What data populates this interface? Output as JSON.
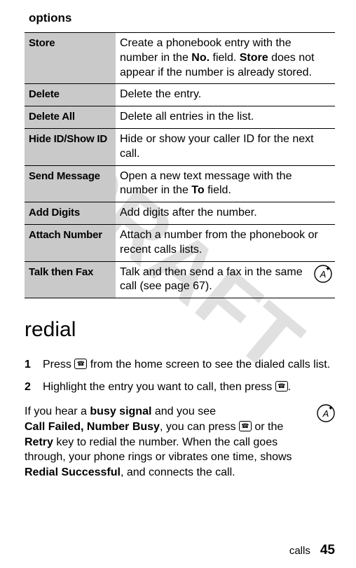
{
  "watermark": "DRAFT",
  "options_header": "options",
  "table": {
    "rows": [
      {
        "label": "Store",
        "desc_pre": "Create a phonebook entry with the number in the ",
        "desc_mid1": "No.",
        "desc_sep1": " field. ",
        "desc_mid2": "Store",
        "desc_post": " does not appear if the number is already stored."
      },
      {
        "label": "Delete",
        "desc": "Delete the entry."
      },
      {
        "label": "Delete All",
        "desc": "Delete all entries in the list."
      },
      {
        "label": "Hide ID/Show ID",
        "desc": "Hide or show your caller ID for the next call."
      },
      {
        "label": "Send Message",
        "desc_pre": "Open a new text message with the number in the ",
        "desc_mid1": "To",
        "desc_post": " field."
      },
      {
        "label": "Add Digits",
        "desc": "Add digits after the number."
      },
      {
        "label": "Attach Number",
        "desc": "Attach a number from the phonebook or recent calls lists."
      },
      {
        "label": "Talk then Fax",
        "desc": "Talk and then send a fax in the same call (see page 67)."
      }
    ]
  },
  "redial_heading": "redial",
  "steps": [
    {
      "num": "1",
      "pre": "Press ",
      "post": " from the home screen to see the dialed calls list."
    },
    {
      "num": "2",
      "pre": "Highlight the entry you want to call, then press ",
      "post": "."
    }
  ],
  "busy_para": {
    "p1": "If you hear a ",
    "busy": "busy signal",
    "p2": " and you see ",
    "cf": "Call Failed, Number Busy",
    "p3": ", you can press ",
    "p4": " or the ",
    "retry": "Retry",
    "p5": " key to redial the number. When the call goes through, your phone rings or vibrates one time, shows ",
    "rs": "Redial Successful",
    "p6": ", and connects the call."
  },
  "footer": {
    "label": "calls",
    "page": "45"
  }
}
